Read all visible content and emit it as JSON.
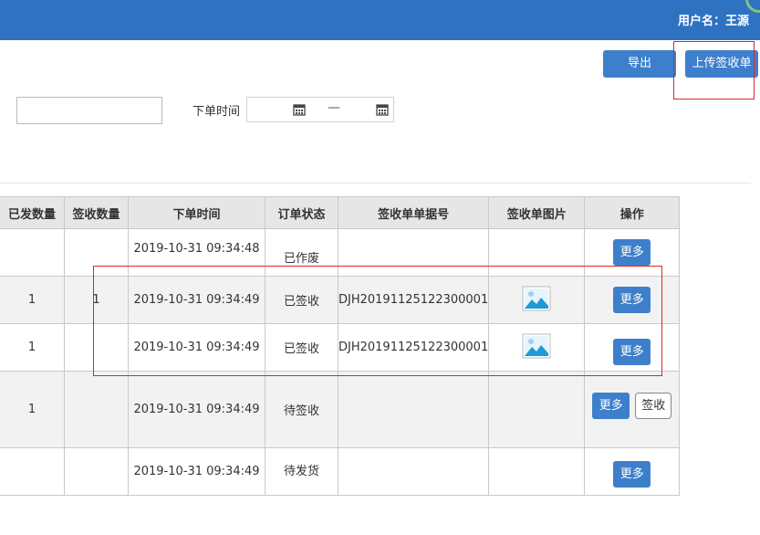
{
  "header": {
    "user_label": "用户名：王源"
  },
  "toolbar": {
    "export_label": "导出",
    "upload_label": "上传签收单"
  },
  "filters": {
    "order_time_label": "下单时间",
    "range_separator": "—"
  },
  "table": {
    "headers": [
      "已发数量",
      "签收数量",
      "下单时间",
      "订单状态",
      "签收单单据号",
      "签收单图片",
      "操作"
    ],
    "rows": [
      {
        "sent": "",
        "signed": "",
        "time": "2019-10-31 09:34:48",
        "status": "已作废",
        "doc_no": "",
        "has_image": false,
        "more": "更多",
        "sign": ""
      },
      {
        "sent": "1",
        "signed": "1",
        "time": "2019-10-31 09:34:49",
        "status": "已签收",
        "doc_no": "DJH20191125122300001",
        "has_image": true,
        "more": "更多",
        "sign": ""
      },
      {
        "sent": "1",
        "signed": "",
        "time": "2019-10-31 09:34:49",
        "status": "已签收",
        "doc_no": "DJH20191125122300001",
        "has_image": true,
        "more": "更多",
        "sign": ""
      },
      {
        "sent": "1",
        "signed": "",
        "time": "2019-10-31 09:34:49",
        "status": "待签收",
        "doc_no": "",
        "has_image": false,
        "more": "更多",
        "sign": "签收"
      },
      {
        "sent": "",
        "signed": "",
        "time": "2019-10-31 09:34:49",
        "status": "待发货",
        "doc_no": "",
        "has_image": false,
        "more": "更多",
        "sign": ""
      }
    ]
  },
  "colors": {
    "topbar": "#2f72c2",
    "button": "#3e7fcc",
    "highlight": "#d9272e",
    "header_bg": "#e6e6e6"
  },
  "icons": {
    "calendar": "calendar-icon",
    "image": "image-thumbnail-icon"
  }
}
